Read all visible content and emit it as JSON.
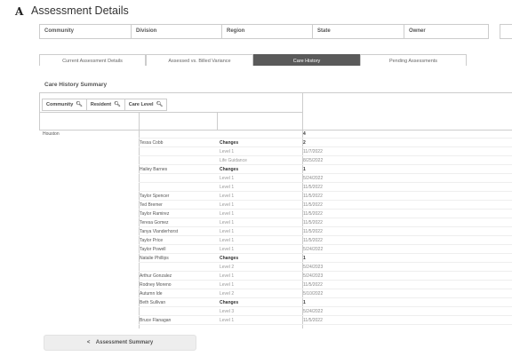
{
  "header": {
    "logo_glyph": "A",
    "title": "Assessment Details"
  },
  "filters": [
    "Community",
    "Division",
    "Region",
    "State",
    "Owner"
  ],
  "tabs": [
    {
      "label": "Current Assessment Details",
      "active": false
    },
    {
      "label": "Assessed vs. Billed Variance",
      "active": false
    },
    {
      "label": "Care History",
      "active": true
    },
    {
      "label": "Pending Assessments",
      "active": false
    }
  ],
  "summary_title": "Care History Summary",
  "search_filters": [
    {
      "label": "Community",
      "icon": "search-icon"
    },
    {
      "label": "Resident",
      "icon": "search-icon"
    },
    {
      "label": "Care Level",
      "icon": "search-icon"
    }
  ],
  "table_rows": [
    {
      "community": "Houston",
      "resident": "",
      "level": "",
      "value": "4",
      "level_bold": false,
      "value_bold": true
    },
    {
      "community": "",
      "resident": "Tessa Cobb",
      "level": "Changes",
      "value": "2",
      "level_bold": true,
      "value_bold": true
    },
    {
      "community": "",
      "resident": "",
      "level": "Level 1",
      "value": "11/7/2022",
      "level_bold": false,
      "value_bold": false
    },
    {
      "community": "",
      "resident": "",
      "level": "Life Guidance",
      "value": "8/25/2022",
      "level_bold": false,
      "value_bold": false
    },
    {
      "community": "",
      "resident": "Hailey Barnes",
      "level": "Changes",
      "value": "1",
      "level_bold": true,
      "value_bold": true
    },
    {
      "community": "",
      "resident": "",
      "level": "Level 1",
      "value": "5/24/2022",
      "level_bold": false,
      "value_bold": false
    },
    {
      "community": "",
      "resident": "",
      "level": "Level 1",
      "value": "11/5/2022",
      "level_bold": false,
      "value_bold": false
    },
    {
      "community": "",
      "resident": "Taylor Spencer",
      "level": "Level 1",
      "value": "11/5/2022",
      "level_bold": false,
      "value_bold": false
    },
    {
      "community": "",
      "resident": "Ted Bremer",
      "level": "Level 1",
      "value": "11/5/2022",
      "level_bold": false,
      "value_bold": false
    },
    {
      "community": "",
      "resident": "Taylor Ramirez",
      "level": "Level 1",
      "value": "11/5/2022",
      "level_bold": false,
      "value_bold": false
    },
    {
      "community": "",
      "resident": "Teresa Gomez",
      "level": "Level 1",
      "value": "11/5/2022",
      "level_bold": false,
      "value_bold": false
    },
    {
      "community": "",
      "resident": "Tanya Vlanderhorst",
      "level": "Level 1",
      "value": "11/5/2022",
      "level_bold": false,
      "value_bold": false
    },
    {
      "community": "",
      "resident": "Taylor Price",
      "level": "Level 1",
      "value": "11/5/2022",
      "level_bold": false,
      "value_bold": false
    },
    {
      "community": "",
      "resident": "Taylor Powell",
      "level": "Level 1",
      "value": "5/24/2022",
      "level_bold": false,
      "value_bold": false
    },
    {
      "community": "",
      "resident": "Natalie Phillips",
      "level": "Changes",
      "value": "1",
      "level_bold": true,
      "value_bold": true
    },
    {
      "community": "",
      "resident": "",
      "level": "Level 2",
      "value": "5/24/2023",
      "level_bold": false,
      "value_bold": false
    },
    {
      "community": "",
      "resident": "Arthur Gonzalez",
      "level": "Level 1",
      "value": "5/24/2023",
      "level_bold": false,
      "value_bold": false
    },
    {
      "community": "",
      "resident": "Rodney Moreno",
      "level": "Level 1",
      "value": "11/5/2022",
      "level_bold": false,
      "value_bold": false
    },
    {
      "community": "",
      "resident": "Autumn Ide",
      "level": "Level 2",
      "value": "5/10/2022",
      "level_bold": false,
      "value_bold": false
    },
    {
      "community": "",
      "resident": "Beth Sullivan",
      "level": "Changes",
      "value": "1",
      "level_bold": true,
      "value_bold": true
    },
    {
      "community": "",
      "resident": "",
      "level": "Level 3",
      "value": "5/24/2022",
      "level_bold": false,
      "value_bold": false
    },
    {
      "community": "",
      "resident": "Bruce Flanagan",
      "level": "Level 1",
      "value": "11/5/2022",
      "level_bold": false,
      "value_bold": false
    }
  ],
  "bottom_button": {
    "chevron": "<",
    "label": "Assessment Summary"
  }
}
